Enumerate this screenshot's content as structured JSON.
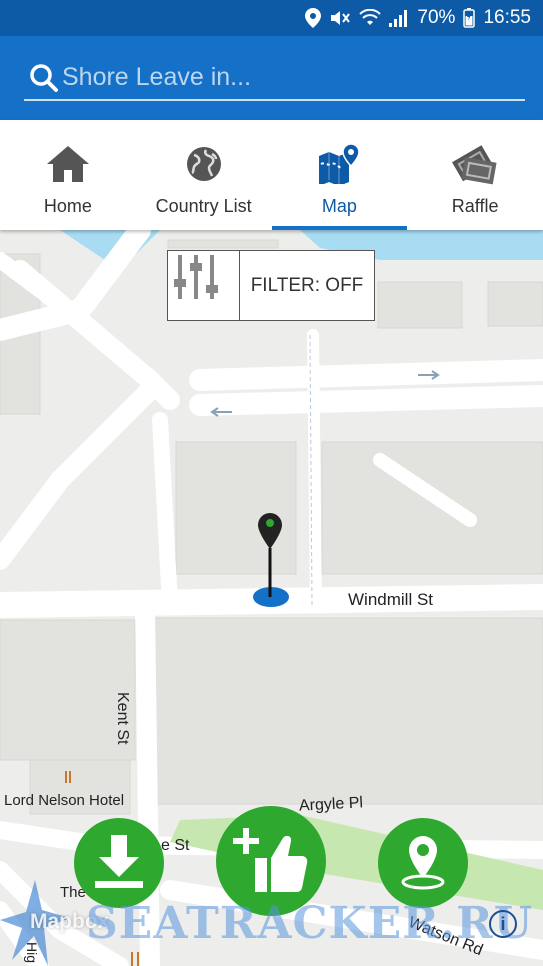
{
  "status_bar": {
    "battery": "70%",
    "time": "16:55"
  },
  "search": {
    "placeholder": "Shore Leave in..."
  },
  "tabs": [
    {
      "label": "Home",
      "icon": "home-icon"
    },
    {
      "label": "Country List",
      "icon": "globe-icon"
    },
    {
      "label": "Map",
      "icon": "map-pin-icon",
      "active": true
    },
    {
      "label": "Raffle",
      "icon": "tickets-icon"
    }
  ],
  "filter": {
    "label": "FILTER: OFF"
  },
  "map": {
    "labels": {
      "windmill_st": "Windmill St",
      "kent_st": "Kent St",
      "lord_nelson": "Lord Nelson Hotel",
      "argyle_pl": "Argyle Pl",
      "e_st": "e St",
      "store": "The     Store",
      "watson_rd": "Watson Rd",
      "hig": "Hig"
    }
  },
  "attribution": {
    "mapbox": "Mapbox",
    "info": "i"
  },
  "watermark": "SEATRACKER.RU",
  "colors": {
    "primary_dark": "#0d5aa7",
    "primary": "#1570c7",
    "fab_green": "#2ea82e",
    "map_bg": "#ededeb",
    "water": "#a7dcf2"
  }
}
